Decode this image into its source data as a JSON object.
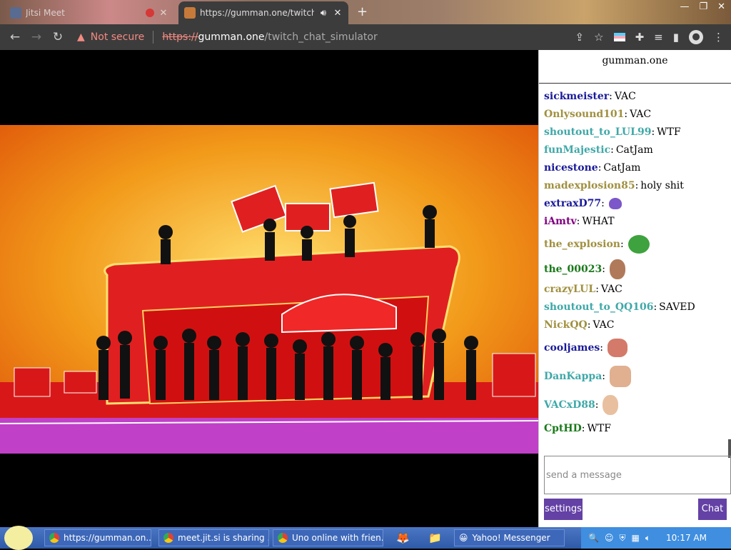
{
  "browser": {
    "tabs": [
      {
        "title": "Jitsi Meet",
        "active": false,
        "recording": true
      },
      {
        "title": "https://gumman.one/twitch_",
        "active": true,
        "audio": true
      }
    ],
    "address": {
      "security_label": "Not secure",
      "protocol": "https://",
      "host": "gumman.one",
      "path": "/twitch_chat_simulator"
    }
  },
  "chat": {
    "title": "gumman.one",
    "messages": [
      {
        "user": "sickmeister",
        "color": "#1a1a9a",
        "text": "VAC"
      },
      {
        "user": "Onlysound101",
        "color": "#a09040",
        "text": "VAC"
      },
      {
        "user": "shoutout_to_LUL99",
        "color": "#40a8a8",
        "text": "WTF"
      },
      {
        "user": "funMajestic",
        "color": "#40a8a8",
        "text": "CatJam"
      },
      {
        "user": "nicestone",
        "color": "#1a1a9a",
        "text": "CatJam"
      },
      {
        "user": "madexplosion85",
        "color": "#a09040",
        "text": "holy shit"
      },
      {
        "user": "extraxD77",
        "color": "#1a1a9a",
        "text": "",
        "emote": "purple-heart-emote"
      },
      {
        "user": "iAmtv",
        "color": "#800080",
        "text": "WHAT"
      },
      {
        "user": "the_explosion",
        "color": "#a09040",
        "text": "",
        "emote": "pepe-frog-emote"
      },
      {
        "user": "the_00023",
        "color": "#1a7a1a",
        "text": "",
        "emote": "face-emote"
      },
      {
        "user": "crazyLUL",
        "color": "#a09040",
        "text": "VAC"
      },
      {
        "user": "shoutout_to_QQ106",
        "color": "#40a8a8",
        "text": "SAVED"
      },
      {
        "user": "NickQQ",
        "color": "#a09040",
        "text": "VAC"
      },
      {
        "user": "cooljames",
        "color": "#1a1a9a",
        "text": "",
        "emote": "lips-emote"
      },
      {
        "user": "DanKappa",
        "color": "#40a8a8",
        "text": "",
        "emote": "shouting-face-emote"
      },
      {
        "user": "VACxD88",
        "color": "#40a8a8",
        "text": "",
        "emote": "bald-face-emote"
      },
      {
        "user": "CptHD",
        "color": "#1a7a1a",
        "text": "WTF"
      }
    ],
    "input_placeholder": "send a message",
    "settings_label": "settings",
    "chat_label": "Chat"
  },
  "taskbar": {
    "tasks": [
      "https://gumman.on...",
      "meet.jit.si is sharing ...",
      "Uno online with frien..."
    ],
    "messenger": "Yahoo! Messenger",
    "clock": "10:17 AM"
  },
  "colors": {
    "accent": "#6441a5",
    "toolbar": "#3c3c3c",
    "taskbar": "#2e5aa8"
  }
}
